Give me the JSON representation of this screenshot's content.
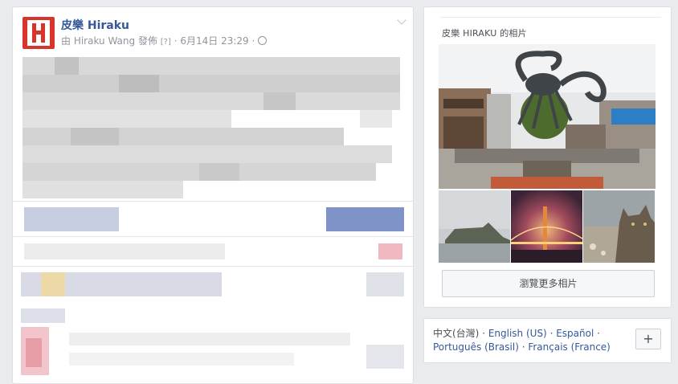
{
  "post": {
    "page_name": "皮樂 Hiraku",
    "meta_prefix": "由 Hiraku Wang 發佈",
    "help_label": "[?]",
    "timestamp": "6月14日 23:29",
    "separator": " · "
  },
  "photos_widget": {
    "title": "皮樂 HIRAKU 的相片",
    "button_label": "瀏覽更多相片",
    "photos": [
      {
        "subject": "Pier 39 crab sculpture"
      },
      {
        "subject": "Alcatraz island"
      },
      {
        "subject": "Golden Gate Bridge at night"
      },
      {
        "subject": "Cat on hillside"
      }
    ]
  },
  "language_bar": {
    "current": "中文(台灣)",
    "sep": " · ",
    "options": [
      "English (US)",
      "Español",
      "Português (Brasil)",
      "Français (France)"
    ],
    "more_button": "+"
  },
  "colors": {
    "link": "#365899",
    "background": "#e9ebee",
    "brand_red": "#d9342b"
  }
}
